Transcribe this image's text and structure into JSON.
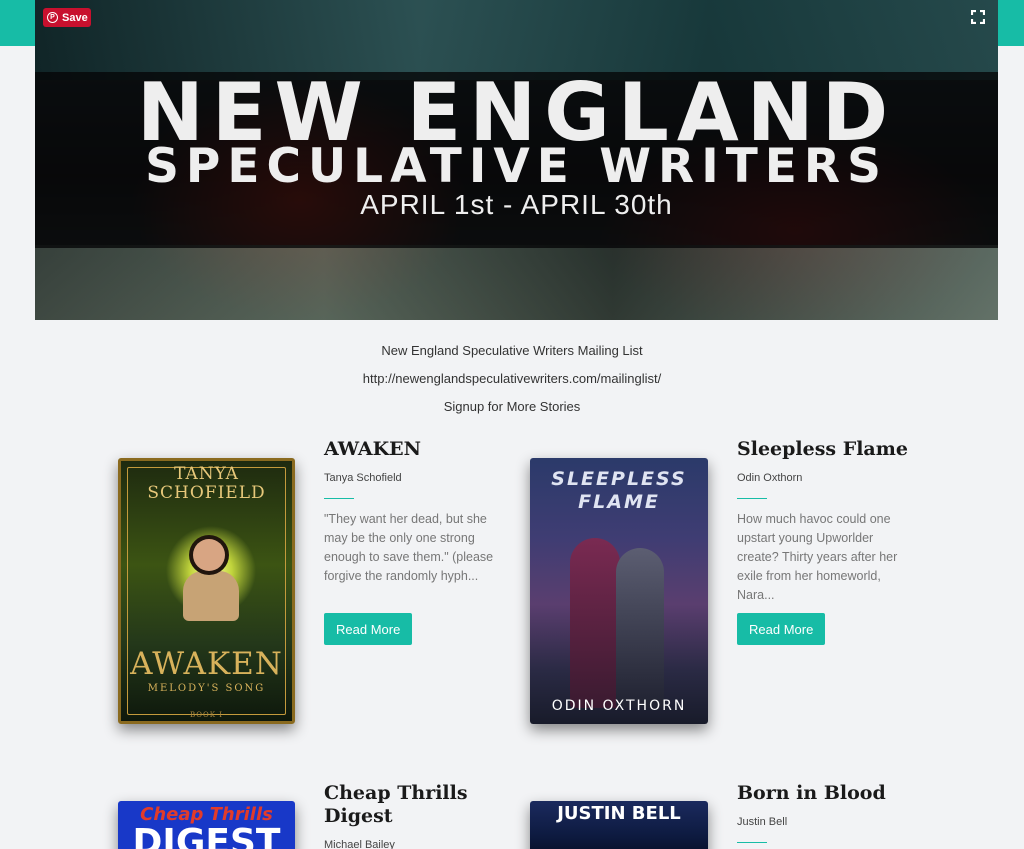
{
  "banner": {
    "line1": "NEW ENGLAND",
    "line2": "SPECULATIVE WRITERS",
    "dates": "APRIL 1st - APRIL 30th",
    "save_label": "Save"
  },
  "intro": {
    "title": "New England Speculative Writers Mailing List",
    "url": "http://newenglandspeculativewriters.com/mailinglist/",
    "signup": "Signup for More Stories"
  },
  "books": [
    {
      "title": "AWAKEN",
      "author": "Tanya Schofield",
      "description": "\"They want her dead, but she may be the only one strong enough to save them.\" (please forgive the randomly hyph...",
      "button": "Read More",
      "cover": {
        "author_text": "TANYA SCHOFIELD",
        "title_text": "AWAKEN",
        "subtitle_text": "MELODY'S SONG",
        "series_text": "BOOK I"
      }
    },
    {
      "title": "Sleepless Flame",
      "author": "Odin Oxthorn",
      "description": "How much havoc could one upstart young Upworlder create? Thirty years after her exile from her homeworld, Nara...",
      "button": "Read More",
      "cover": {
        "title_text": "SLEEPLESS FLAME",
        "author_text": "ODIN OXTHORN"
      }
    },
    {
      "title": "Cheap Thrills Digest",
      "author": "Michael Bailey",
      "cover": {
        "title_text": "Cheap Thrills",
        "subtitle_text": "DIGEST"
      }
    },
    {
      "title": "Born in Blood",
      "author": "Justin Bell",
      "cover": {
        "author_text": "JUSTIN BELL"
      }
    }
  ],
  "colors": {
    "accent": "#17bca6",
    "pinterest": "#c8102e",
    "background": "#f2f3f5"
  }
}
